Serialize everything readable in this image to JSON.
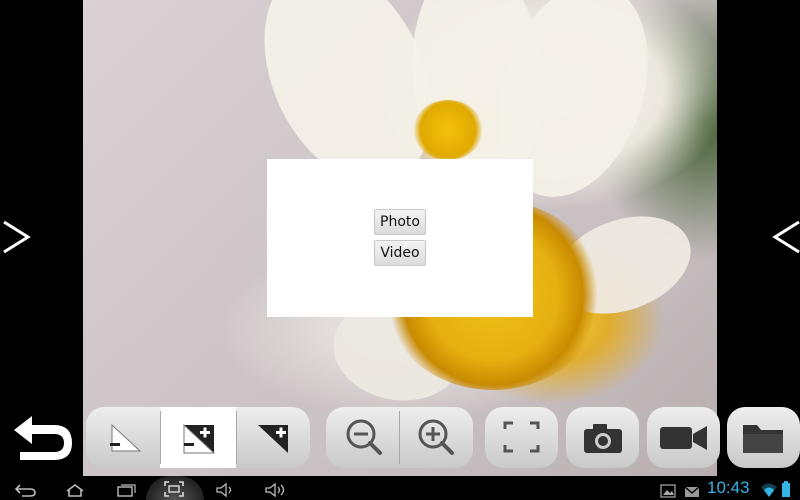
{
  "viewer": {
    "prev_arrow": ">",
    "next_arrow": "<"
  },
  "capture_dialog": {
    "options": [
      "Photo",
      "Video"
    ]
  },
  "toolbar": {
    "back_icon": "back-arrow-icon",
    "mode_group": [
      "contrast-minus-icon",
      "contrast-both-icon",
      "contrast-plus-icon"
    ],
    "active_mode_index": 1,
    "zoom_group": [
      "zoom-out-icon",
      "zoom-in-icon"
    ],
    "buttons": [
      "fullscreen-icon",
      "camera-icon",
      "video-camera-icon",
      "folder-icon"
    ]
  },
  "status_bar": {
    "time": "10:43",
    "time_color": "#33b5e5",
    "icons": [
      "back-icon",
      "home-icon",
      "recent-apps-icon",
      "screenshot-icon",
      "volume-down-icon",
      "volume-up-icon",
      "gallery-icon",
      "gmail-icon",
      "wifi-icon",
      "battery-icon"
    ]
  }
}
